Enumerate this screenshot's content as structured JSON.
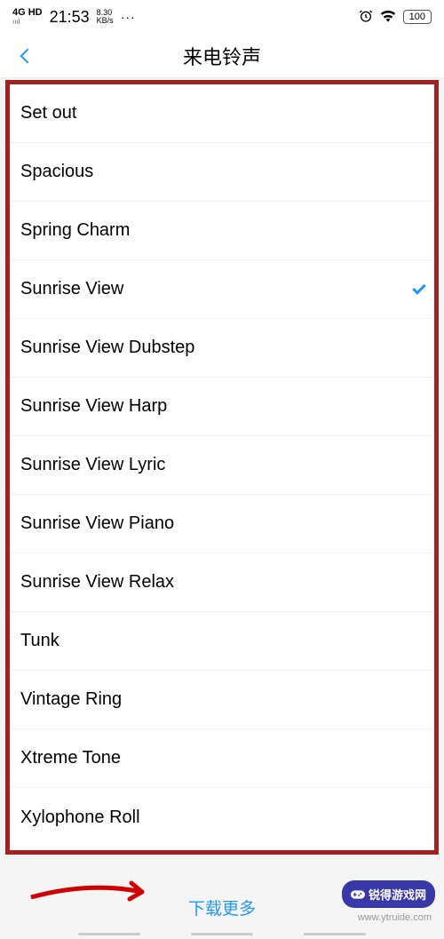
{
  "statusBar": {
    "network": "4G HD",
    "signal": "ıııl",
    "time": "21:53",
    "speedTop": "8.30",
    "speedBottom": "KB/s",
    "dots": "···",
    "battery": "100"
  },
  "header": {
    "title": "来电铃声"
  },
  "ringtones": [
    {
      "name": "Set out",
      "selected": false
    },
    {
      "name": "Spacious",
      "selected": false
    },
    {
      "name": "Spring Charm",
      "selected": false
    },
    {
      "name": "Sunrise View",
      "selected": true
    },
    {
      "name": "Sunrise View Dubstep",
      "selected": false
    },
    {
      "name": "Sunrise View Harp",
      "selected": false
    },
    {
      "name": "Sunrise View Lyric",
      "selected": false
    },
    {
      "name": "Sunrise View Piano",
      "selected": false
    },
    {
      "name": "Sunrise View Relax",
      "selected": false
    },
    {
      "name": "Tunk",
      "selected": false
    },
    {
      "name": "Vintage Ring",
      "selected": false
    },
    {
      "name": "Xtreme Tone",
      "selected": false
    },
    {
      "name": "Xylophone Roll",
      "selected": false
    }
  ],
  "footer": {
    "downloadMore": "下载更多"
  },
  "watermark": {
    "brand": "锐得游戏网",
    "url": "www.ytruide.com"
  },
  "annotation": {
    "highlightColor": "#a32020",
    "arrowColor": "#d00000"
  }
}
